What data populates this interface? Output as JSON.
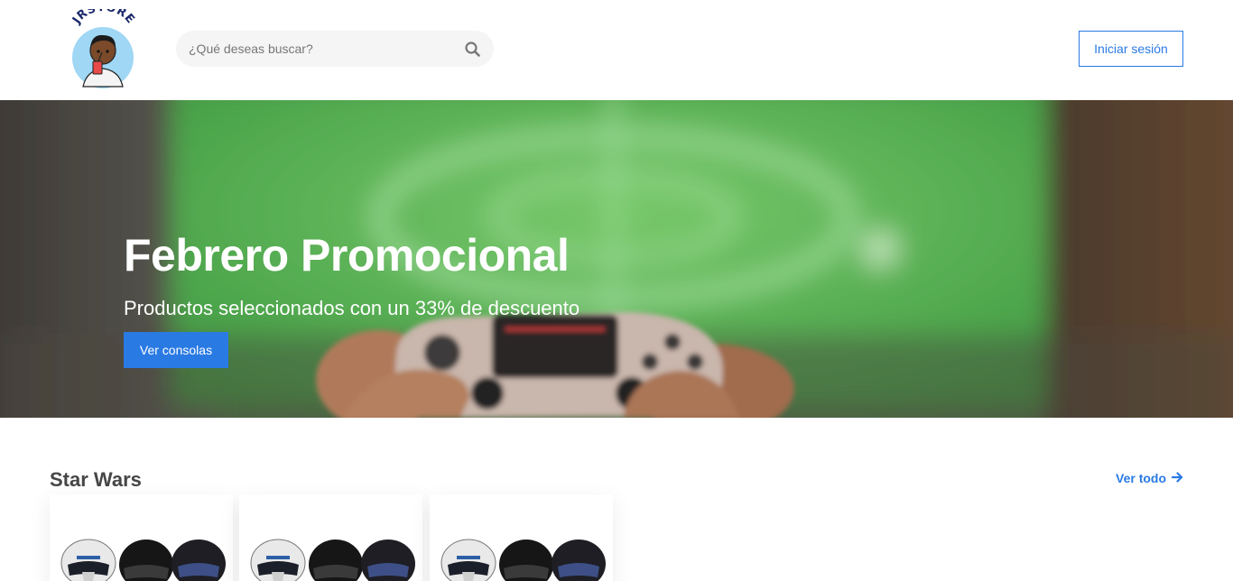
{
  "header": {
    "logo_text": "JRSTORE",
    "search": {
      "placeholder": "¿Qué deseas buscar?",
      "value": "",
      "icon": "search-icon"
    },
    "login_label": "Iniciar sesión"
  },
  "hero": {
    "title": "Febrero Promocional",
    "subtitle": "Productos seleccionados con un 33% de descuento",
    "button_label": "Ver consolas"
  },
  "section": {
    "title": "Star Wars",
    "see_all_label": "Ver todo",
    "see_all_icon": "arrow-right-icon",
    "products": [
      {
        "image": "helmets-image"
      },
      {
        "image": "helmets-image"
      },
      {
        "image": "helmets-image"
      }
    ]
  },
  "colors": {
    "accent": "#2a7ae4",
    "text": "#464646",
    "search_bg": "#f5f5f5"
  }
}
